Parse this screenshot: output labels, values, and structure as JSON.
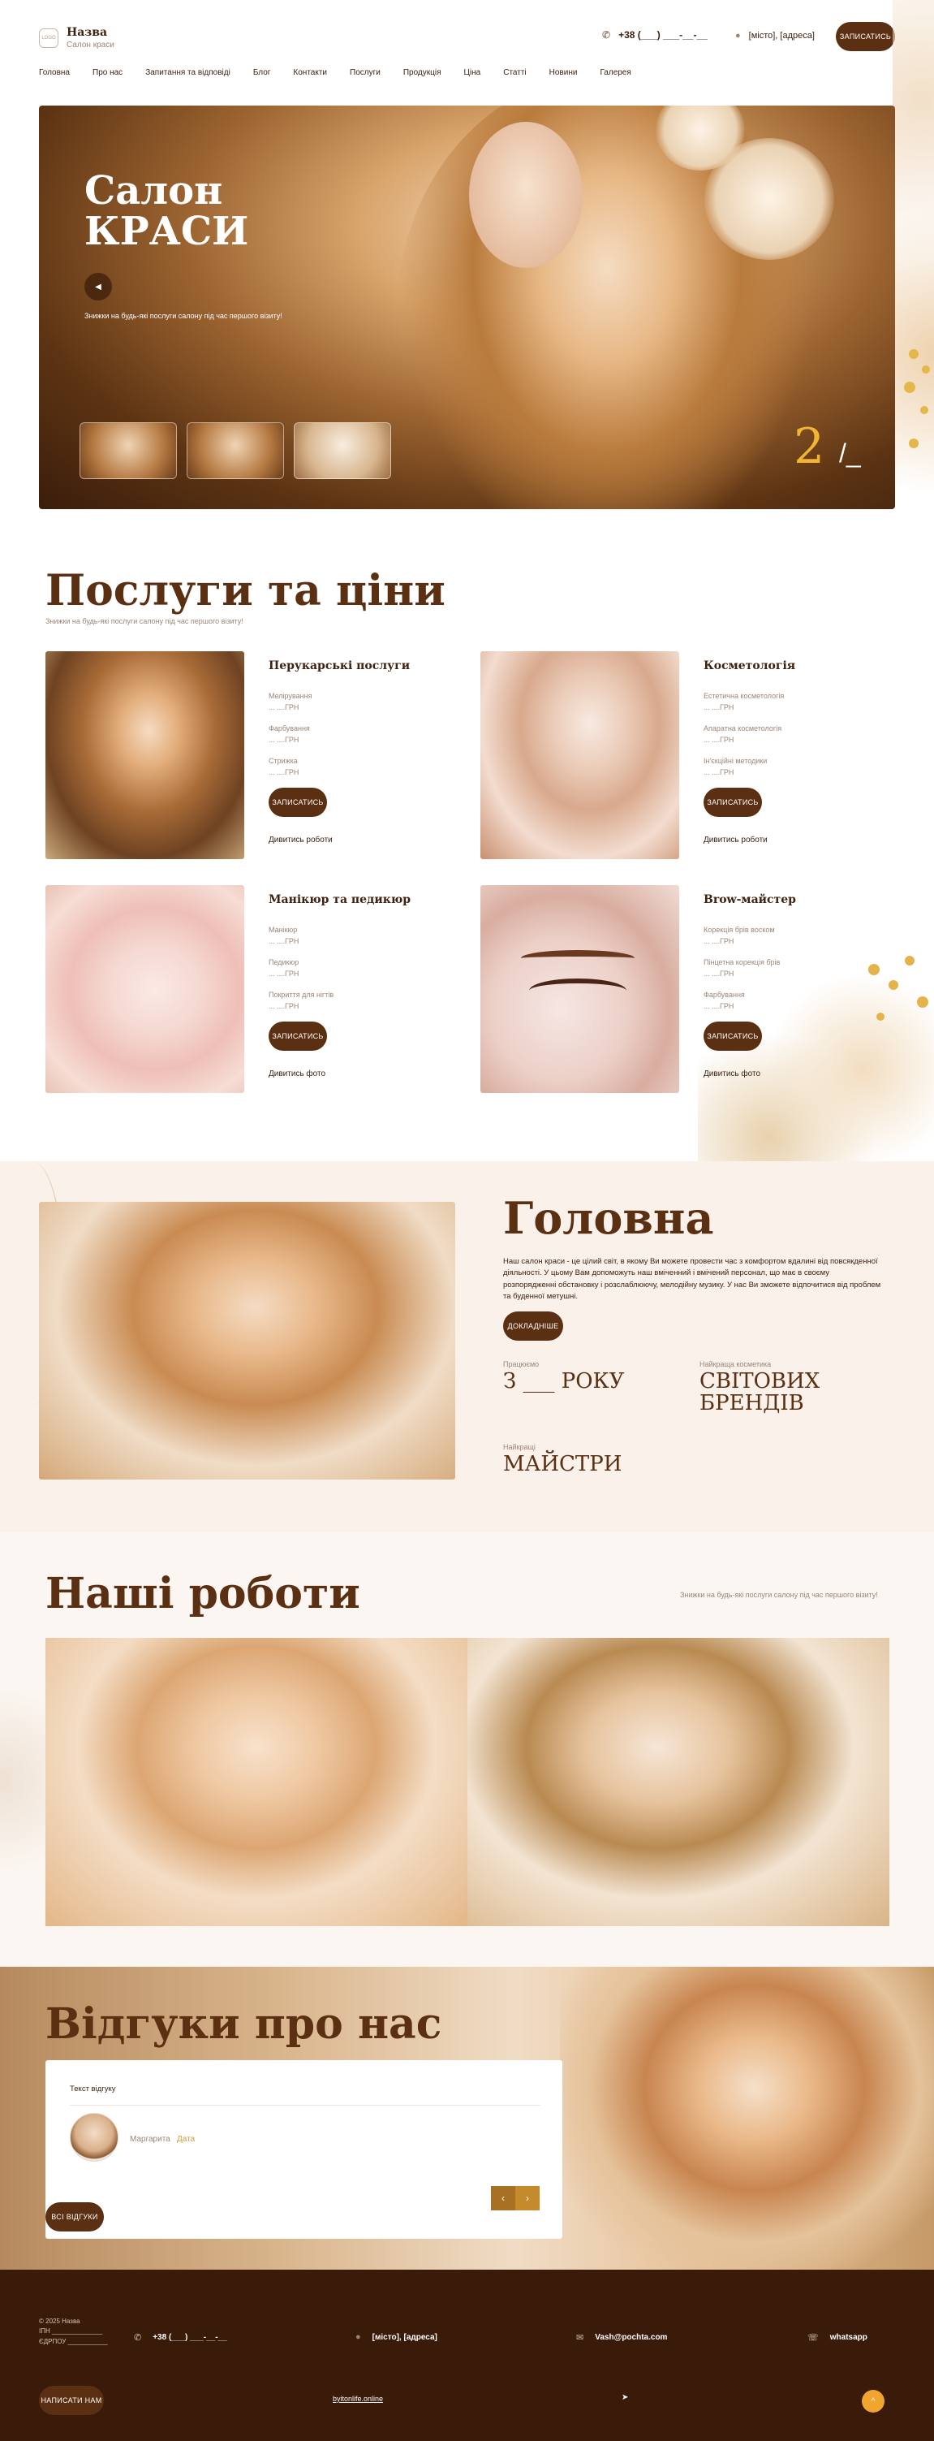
{
  "header": {
    "logo_mark": "LOGO",
    "logo_title": "Назва",
    "logo_sub": "Салон краси",
    "phone": "+38 (___) ___-__-__",
    "address": "[місто], [адреса]",
    "cta": "записатись"
  },
  "nav": [
    "Головна",
    "Про нас",
    "Запитання та відповіді",
    "Блог",
    "Контакти",
    "Послуги",
    "Продукція",
    "Ціна",
    "Статті",
    "Новини",
    "Галерея"
  ],
  "hero": {
    "title_line1": "Салон",
    "title_line2": "КРАСИ",
    "subtitle": "Знижки на будь-які послуги салону під час першого візиту!",
    "slide_current": "2",
    "slide_sep": "/",
    "slide_total": "_"
  },
  "services": {
    "title": "Послуги та ціни",
    "subtitle": "Знижки на будь-які послуги салону під час першого візиту!",
    "cards": [
      {
        "name": "Перукарські послуги",
        "items": [
          {
            "label": "Мелірування",
            "price": "... ....ГРН"
          },
          {
            "label": "Фарбування",
            "price": "... ....ГРН"
          },
          {
            "label": "Стрижка",
            "price": "... ....ГРН"
          }
        ],
        "button": "записатись",
        "link": "Дивитись роботи"
      },
      {
        "name": "Косметологія",
        "items": [
          {
            "label": "Естетична косметологія",
            "price": "... ....ГРН"
          },
          {
            "label": "Апаратна косметологія",
            "price": "... ....ГРН"
          },
          {
            "label": "Ін'єкційні методики",
            "price": "... ....ГРН"
          }
        ],
        "button": "записатись",
        "link": "Дивитись роботи"
      },
      {
        "name": "Манікюр та педикюр",
        "items": [
          {
            "label": "Манікюр",
            "price": "... ....ГРН"
          },
          {
            "label": "Педикюр",
            "price": "... ....ГРН"
          },
          {
            "label": "Покриття для нігтів",
            "price": "... ....ГРН"
          }
        ],
        "button": "записатись",
        "link": "Дивитись фото"
      },
      {
        "name": "Brow-майстер",
        "items": [
          {
            "label": "Корекція брів воском",
            "price": "... ....ГРН"
          },
          {
            "label": "Пінцетна корекція брів",
            "price": "... ....ГРН"
          },
          {
            "label": "Фарбування",
            "price": "... ....ГРН"
          }
        ],
        "button": "записатись",
        "link": "Дивитись фото"
      }
    ]
  },
  "about": {
    "title": "Головна",
    "text": "Наш салон краси - це цілий світ, в якому Ви можете провести час з комфортом вдалині від повсякденної діяльності. У цьому Вам допоможуть наш вміченний і вмічений персонал, що має в своєму розпорядженні обстановку і розслаблюючу, мелодійну музику. У нас Ви зможете відпочитися від проблем та буденної метушні.",
    "button": "докладніше",
    "stats": [
      {
        "label": "Працюємо",
        "value": "З ___ РОКУ"
      },
      {
        "label": "Найкраща косметика",
        "value": "СВІТОВИХ БРЕНДІВ"
      },
      {
        "label": "Найкращі",
        "value": "МАЙСТРИ"
      }
    ]
  },
  "works": {
    "title": "Наші роботи",
    "subtitle": "Знижки на будь-які послуги салону під час першого візиту!"
  },
  "reviews": {
    "title": "Відгуки про нас",
    "text": "Текст відгуку",
    "name": "Маргарита",
    "date": "Дата",
    "button": "всі відгуки",
    "prev": "‹",
    "next": "›"
  },
  "footer": {
    "copyright_line1": "© 2025 Назва",
    "copyright_line2": "ІПН ______________",
    "copyright_line3": "ЄДРПОУ ___________",
    "phone": "+38 (___) ___-__-__",
    "address": "[місто], [адреса]",
    "email": "Vash@pochta.com",
    "whatsapp": "whatsapp",
    "button": "написати нам",
    "site_link": "byitonlife.online",
    "up": "^"
  }
}
